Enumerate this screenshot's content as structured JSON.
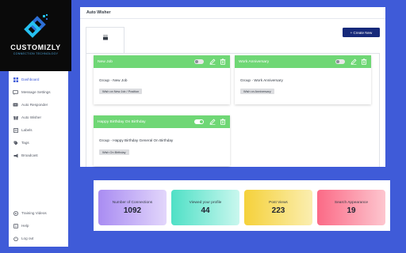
{
  "brand": {
    "name": "CUSTOMIZLY",
    "tagline": "CONNECTION TECHNOLOGY",
    "colors": {
      "background": "#0a0a0a",
      "mark_blue": "#2d6fd6",
      "mark_cyan": "#25c0f0"
    }
  },
  "sidebar": {
    "items": [
      {
        "label": "Dashboard",
        "icon": "grid-icon",
        "active": true
      },
      {
        "label": "Message Settings",
        "icon": "message-icon",
        "active": false
      },
      {
        "label": "Auto Responder",
        "icon": "autoresponder-icon",
        "active": false
      },
      {
        "label": "Auto Wisher",
        "icon": "gift-icon",
        "active": false
      },
      {
        "label": "Labels",
        "icon": "label-icon",
        "active": false
      },
      {
        "label": "Tags",
        "icon": "tag-icon",
        "active": false
      },
      {
        "label": "Broadcast",
        "icon": "broadcast-icon",
        "active": false
      },
      {
        "label": "Training Videos",
        "icon": "video-icon",
        "active": false
      },
      {
        "label": "Help",
        "icon": "help-icon",
        "active": false
      },
      {
        "label": "Log out",
        "icon": "logout-icon",
        "active": false
      }
    ]
  },
  "main": {
    "title": "Auto Wisher",
    "tab_icon": "cake-icon",
    "create_button": "+ Create New",
    "cards": [
      {
        "title": "New Job",
        "enabled": false,
        "group": "Group - New Job",
        "message": "Wish on New Job / Position"
      },
      {
        "title": "Work Anniversary",
        "enabled": false,
        "group": "Group - Work Anniversary",
        "message": "Wish on Anniversary"
      },
      {
        "title": "Happy Birthday On Birthday",
        "enabled": true,
        "group": "Group - Happy Birthday General On Birthday",
        "message": "Wish On Birthday"
      }
    ]
  },
  "stats": [
    {
      "label": "Number of Connections",
      "value": "1092",
      "gradient": [
        "#a98cf2",
        "#e2d6fb"
      ]
    },
    {
      "label": "Viewed your profile",
      "value": "44",
      "gradient": [
        "#4fe0c6",
        "#c9f7ee"
      ]
    },
    {
      "label": "Post Views",
      "value": "223",
      "gradient": [
        "#f5d13a",
        "#fbeeb0"
      ]
    },
    {
      "label": "Search Appearance",
      "value": "19",
      "gradient": [
        "#fb6a86",
        "#fdc6cf"
      ]
    }
  ],
  "colors": {
    "page_bg": "#3f5bd8",
    "accent": "#16297a",
    "card_header": "#6fd775",
    "badge": "#dcdde0"
  }
}
